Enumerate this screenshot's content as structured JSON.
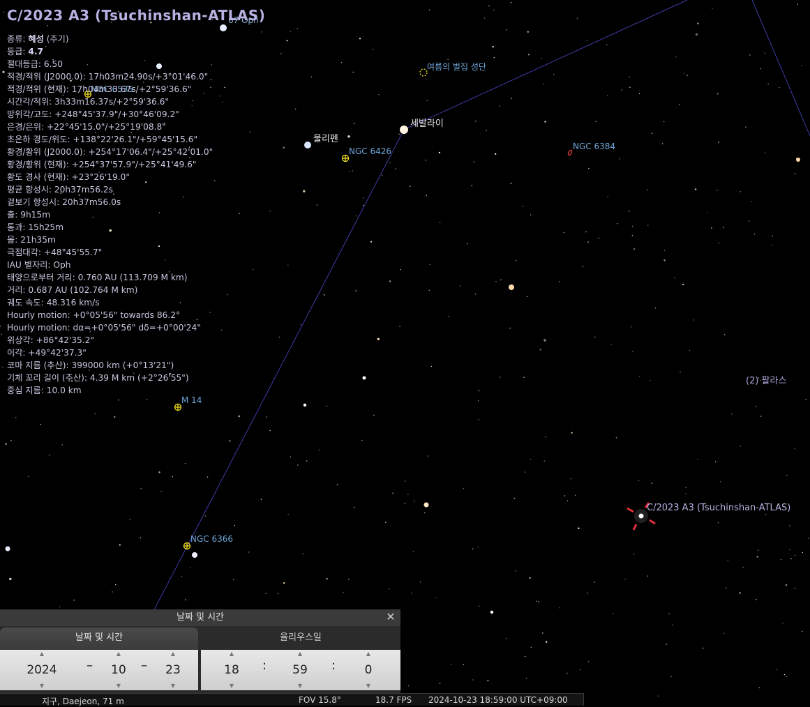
{
  "object_title": "C/2023 A3 (Tsuchinshan-ATLAS)",
  "info_rows": [
    {
      "k": "종류:",
      "v": "혜성",
      "extra": " (주기)",
      "bold": true
    },
    {
      "k": "등급:",
      "v": "4.7",
      "bold": true
    },
    {
      "k": "절대등급:",
      "v": "6.50"
    },
    {
      "k": "적경/적위 (J2000.0):",
      "v": "17h03m24.90s/+3°01'46.0\""
    },
    {
      "k": "적경/적위 (현재):",
      "v": "17h04m33.67s/+2°59'36.6\""
    },
    {
      "k": "시간각/적위:",
      "v": "3h33m16.37s/+2°59'36.6\""
    },
    {
      "k": "방위각/고도:",
      "v": "+248°45'37.9\"/+30°46'09.2\""
    },
    {
      "k": "은경/은위:",
      "v": "+22°45'15.0\"/+25°19'08.8\""
    },
    {
      "k": "초은하 경도/위도:",
      "v": "+138°22'26.1\"/+59°45'15.6\""
    },
    {
      "k": "황경/황위 (J2000.0):",
      "v": "+254°17'06.4\"/+25°42'01.0\""
    },
    {
      "k": "황경/황위 (현재):",
      "v": "+254°37'57.9\"/+25°41'49.6\""
    },
    {
      "k": "황도 경사 (현재):",
      "v": "+23°26'19.0\""
    },
    {
      "k": "평균 항성시:",
      "v": "20h37m56.2s"
    },
    {
      "k": "겉보기 항성시:",
      "v": "20h37m56.0s"
    },
    {
      "k": "출:",
      "v": "9h15m"
    },
    {
      "k": "통과:",
      "v": "15h25m"
    },
    {
      "k": "몰:",
      "v": "21h35m"
    },
    {
      "k": "극점대각:",
      "v": "+48°45'55.7\""
    },
    {
      "k": "IAU 별자리:",
      "v": "Oph"
    },
    {
      "k": "태양으로부터 거리:",
      "v": "0.760 AU (113.709 M km)"
    },
    {
      "k": "거리:",
      "v": "0.687 AU (102.764 M km)"
    },
    {
      "k": "궤도 속도:",
      "v": "48.316 km/s"
    },
    {
      "k": "Hourly motion:",
      "v": "+0°05'56\" towards 86.2°"
    },
    {
      "k": "Hourly motion:",
      "v": "dα=+0°05'56\" dδ=+0°00'24\""
    },
    {
      "k": "위상각:",
      "v": "+86°42'35.2\""
    },
    {
      "k": "이각:",
      "v": "+49°42'37.3\""
    },
    {
      "k": "코마 지름 (추산):",
      "v": "399000 km (+0°13'21\")"
    },
    {
      "k": "기체 꼬리 길이 (추산):",
      "v": "4.39 M km (+2°26'55\")"
    },
    {
      "k": "중심 지름:",
      "v": "10.0 km"
    }
  ],
  "sky_labels": {
    "star_67oph": "67 Oph",
    "cluster_summer": "여름의 벌집 성단",
    "star_cebalrai": "세발라이",
    "star_mulliphen": "물리펜",
    "ngc6426": "NGC 6426",
    "ngc6384": "NGC 6384",
    "ngc6535": "NGC 6535",
    "m14": "M 14",
    "ngc6366": "NGC 6366",
    "pallas": "(2) 팔라스",
    "comet": "C/2023 A3 (Tsuchinshan-ATLAS)"
  },
  "datetime_panel": {
    "title": "날짜 및 시간",
    "tab_active": "날짜 및 시간",
    "tab_other": "율리우스일",
    "year": "2024",
    "month": "10",
    "day": "23",
    "hour": "18",
    "minute": "59",
    "second": "0",
    "date_sep": "–",
    "time_sep": ":"
  },
  "status_bar": {
    "location": "지구, Daejeon, 71 m",
    "fov": "FOV 15.8°",
    "fps": "18.7 FPS",
    "datetime": "2024-10-23 18:59:00 UTC+09:00"
  },
  "colors": {
    "constellation_line": "#3c3ca8",
    "comet_marker": "#e0303a",
    "dso_marker": "#f0e020"
  }
}
